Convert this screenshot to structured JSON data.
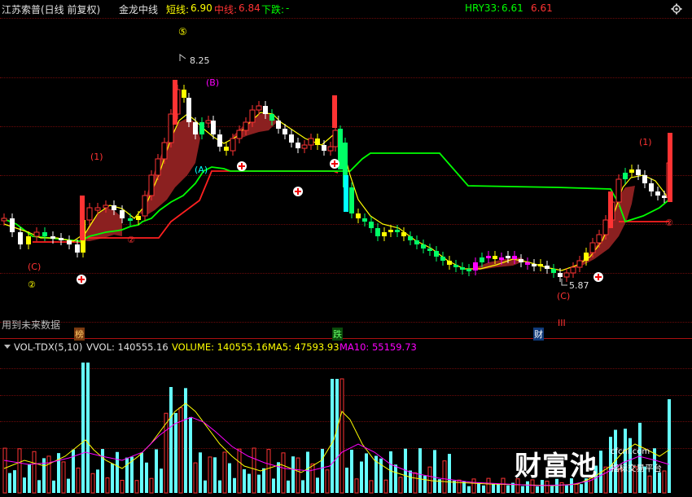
{
  "header": {
    "stock_name": "江苏索普(日线 前复权)",
    "indicator_name": "金龙中线",
    "short_label": "短线:",
    "short_value": "6.90",
    "mid_label": "中线:",
    "mid_value": "6.84",
    "down_label": "下跌:",
    "down_value": "-",
    "hry_label": "HRY33:",
    "hry_value": "6.61",
    "hry_extra": "6.61"
  },
  "annotations": {
    "wave5": "⑤",
    "high_price": "8.25",
    "wave_B": "(B)",
    "wave_A": "(A)",
    "wave1_left": "(1)",
    "wave2_left": "②",
    "waveC_left": "(C)",
    "wave2_mid": "②",
    "wave1_right": "(1)",
    "wave2_right": "②",
    "low_price": "5.87",
    "waveC_bottom": "(C)",
    "roman3": "III",
    "future_data": "用到未来数据",
    "tag_bang": "榜",
    "tag_die": "跌",
    "tag_cai": "财"
  },
  "volume_header": {
    "name": "VOL-TDX(5,10)",
    "vvol": "VVOL: 140555.16",
    "volume": "VOLUME: 140555.16",
    "ma5": "MA5: 47593.93",
    "ma10": "MA10: 55159.73"
  },
  "watermark": {
    "brand": "财富池",
    "url": "cfcni.com",
    "subtitle": "指标交易平台"
  },
  "colors": {
    "up": "#ff3333",
    "down": "#00ffff",
    "green_line": "#00ff00",
    "ribbon": "#8b2020",
    "yellow": "#ffff00",
    "magenta": "#ff00ff"
  }
}
